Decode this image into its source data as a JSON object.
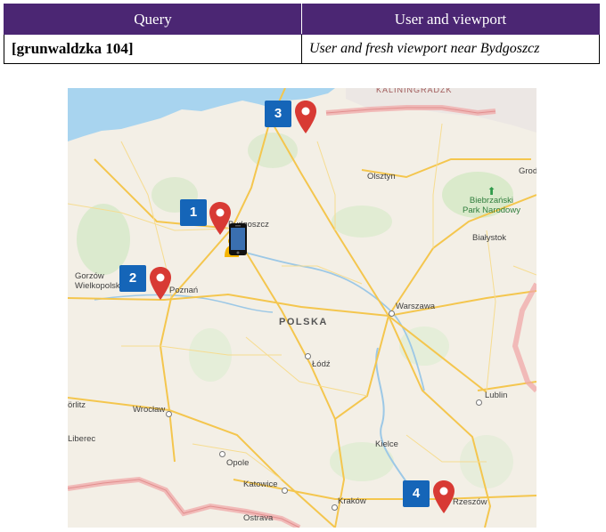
{
  "table": {
    "headers": [
      "Query",
      "User and viewport"
    ],
    "query": "[grunwaldzka 104]",
    "viewport": "User and fresh viewport near Bydgoszcz"
  },
  "map": {
    "country_label": "POLSKA",
    "border_label": "KALININGRADZK",
    "cities": {
      "bydgoszcz": "Bydgoszcz",
      "olsztyn": "Olsztyn",
      "grod": "Grod",
      "bialystok": "Białystok",
      "gorzow_line1": "Gorzów",
      "gorzow_line2": "Wielkopolski",
      "poznan": "Poznań",
      "warszawa": "Warszawa",
      "lodz": "Łódź",
      "lublin": "Lublin",
      "wroclaw": "Wrocław",
      "oritz": "örlitz",
      "liberec": "Liberec",
      "kielce": "Kielce",
      "opole": "Opole",
      "katowice": "Katowice",
      "krakow": "Kraków",
      "rzeszow": "Rzeszów",
      "ostrava": "Ostrava"
    },
    "park_line1": "Biebrzański",
    "park_line2": "Park Narodowy",
    "markers": [
      {
        "label": "1",
        "color": "#d83a34"
      },
      {
        "label": "2",
        "color": "#d83a34"
      },
      {
        "label": "3",
        "color": "#d83a34"
      },
      {
        "label": "4",
        "color": "#d83a34"
      }
    ],
    "badge_color": "#1565b8",
    "user_icon": "phone-with-person-icon"
  }
}
